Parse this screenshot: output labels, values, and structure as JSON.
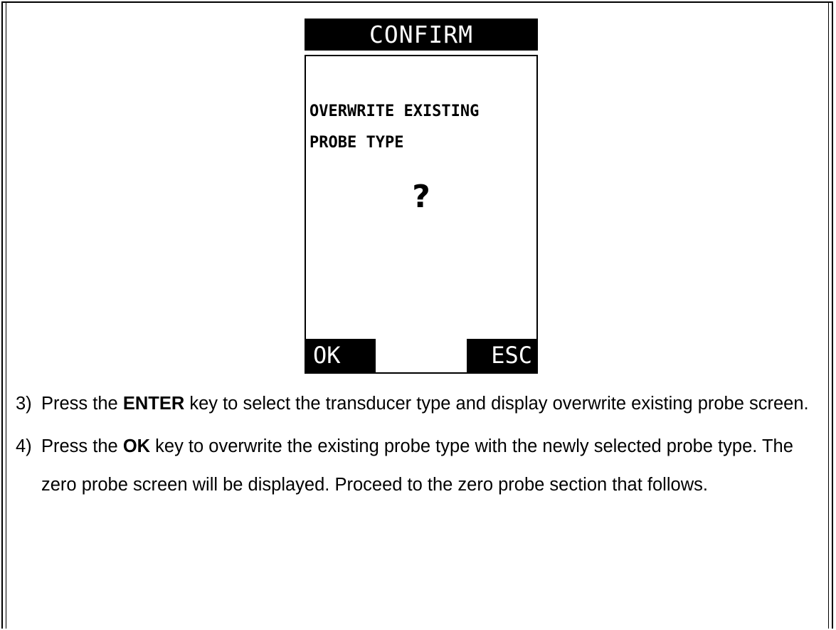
{
  "screen": {
    "title": "CONFIRM",
    "message_line1": "OVERWRITE EXISTING",
    "message_line2": "PROBE TYPE",
    "question": "?",
    "ok_label": "OK",
    "esc_label": "ESC"
  },
  "steps": [
    {
      "number": "3)",
      "before": "Press the ",
      "key": "ENTER",
      "after": " key to select the transducer type and display overwrite existing probe screen."
    },
    {
      "number": "4)",
      "before": "Press the ",
      "key": "OK",
      "after": " key to overwrite the existing probe type with the newly selected probe type.  The zero probe screen will be displayed.  Proceed to the zero probe section that follows."
    }
  ]
}
